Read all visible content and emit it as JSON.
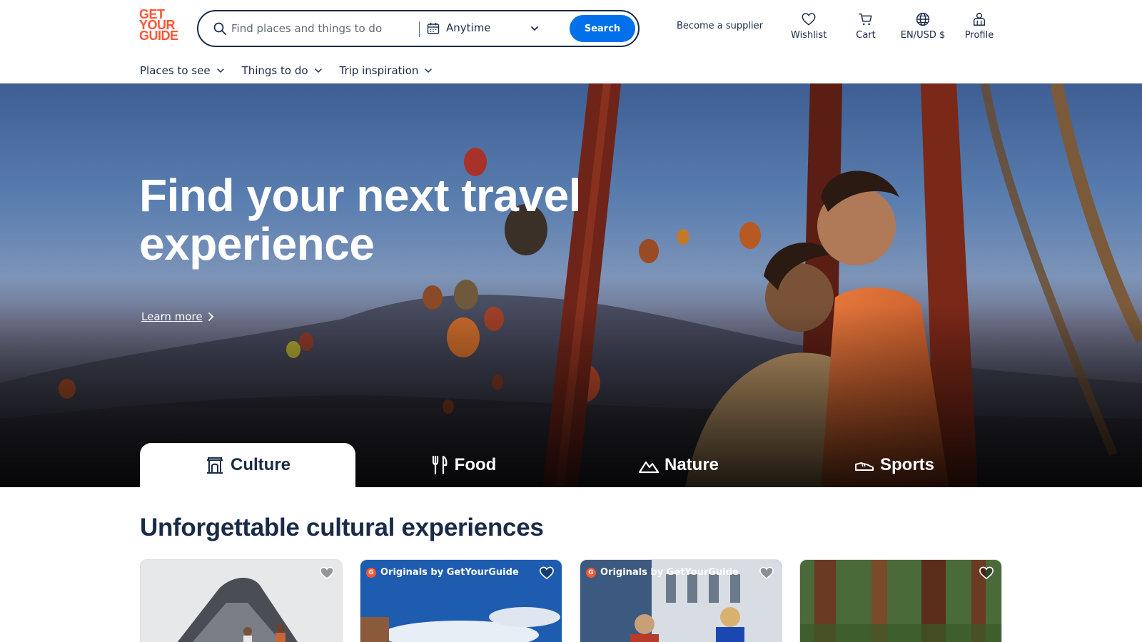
{
  "header": {
    "logo_lines": [
      "GET",
      "YOUR",
      "GUIDE"
    ],
    "search": {
      "placeholder": "Find places and things to do",
      "date_label": "Anytime",
      "button_label": "Search"
    },
    "supplier_label": "Become a supplier",
    "wishlist_label": "Wishlist",
    "cart_label": "Cart",
    "locale_label": "EN/USD $",
    "profile_label": "Profile"
  },
  "subnav": {
    "items": [
      {
        "label": "Places to see"
      },
      {
        "label": "Things to do"
      },
      {
        "label": "Trip inspiration"
      }
    ]
  },
  "hero": {
    "title_line1": "Find your next travel",
    "title_line2": "experience",
    "learn_more": "Learn more",
    "tabs": [
      {
        "label": "Culture",
        "icon": "museum-icon",
        "active": true
      },
      {
        "label": "Food",
        "icon": "fork-knife-icon",
        "active": false
      },
      {
        "label": "Nature",
        "icon": "mountain-icon",
        "active": false
      },
      {
        "label": "Sports",
        "icon": "sneaker-icon",
        "active": false
      }
    ]
  },
  "section": {
    "title": "Unforgettable cultural experiences",
    "cards": [
      {
        "badge": ""
      },
      {
        "badge": "Originals by GetYourGuide"
      },
      {
        "badge": "Originals by GetYourGuide"
      },
      {
        "badge": ""
      }
    ]
  },
  "colors": {
    "brand": "#ff5533",
    "primary_button": "#0071eb",
    "text": "#1a2b49"
  }
}
